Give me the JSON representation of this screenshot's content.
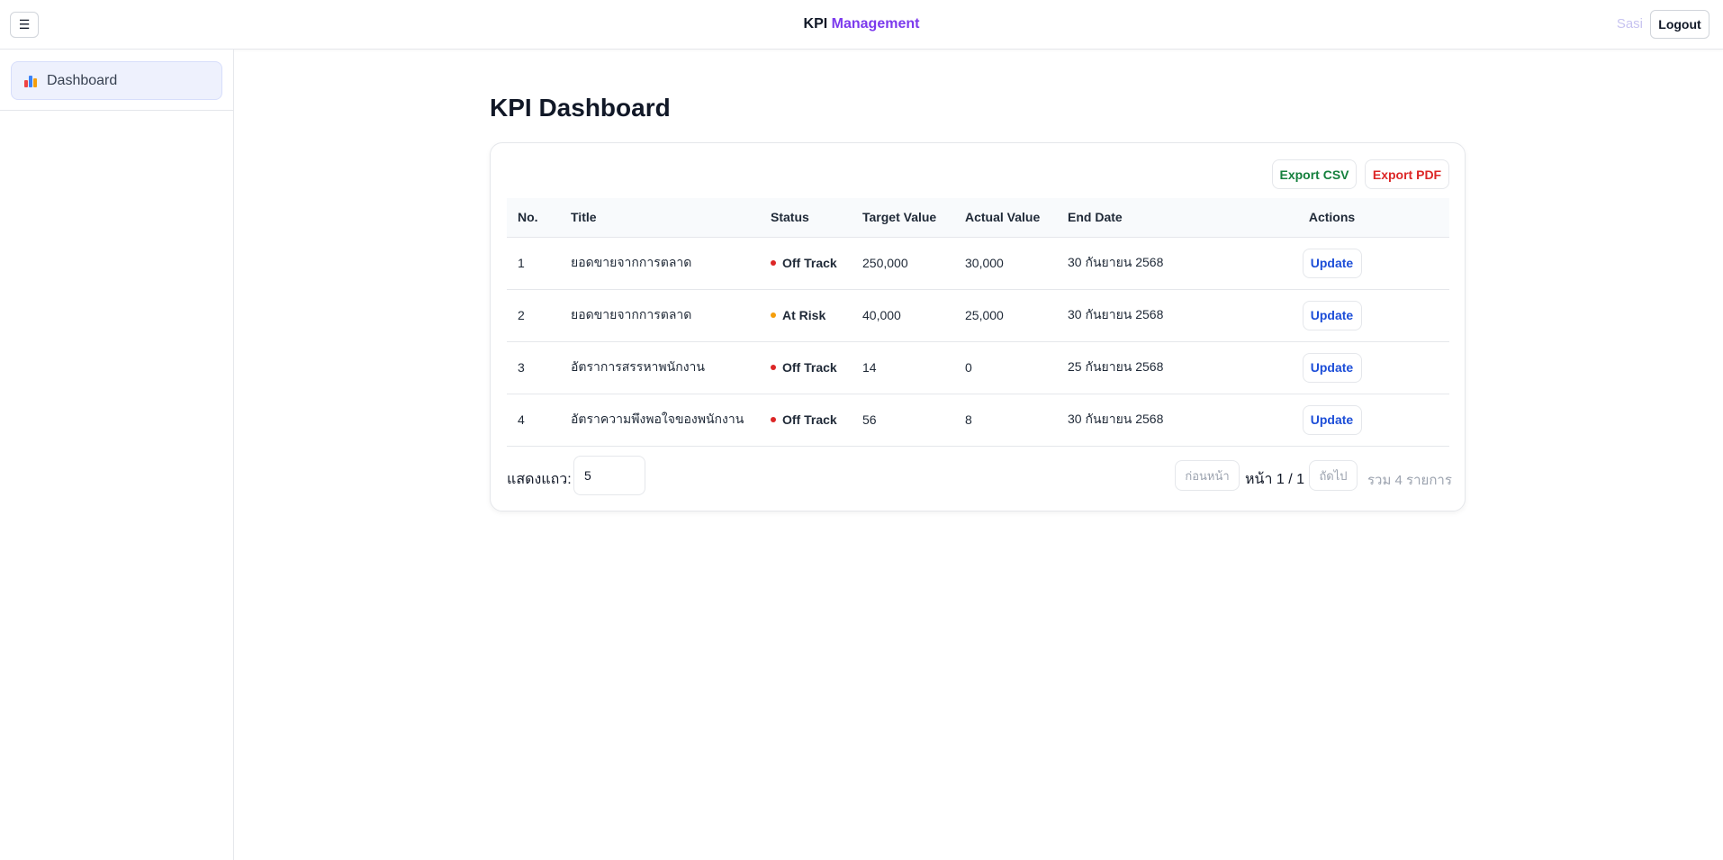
{
  "header": {
    "menu_icon": "☰",
    "brand_kpi": "KPI",
    "brand_management": "Management",
    "user_name": "Sasi",
    "logout_label": "Logout"
  },
  "sidebar": {
    "items": [
      {
        "label": "Dashboard",
        "icon": "bar-chart-icon",
        "active": true
      }
    ]
  },
  "main": {
    "title": "KPI Dashboard",
    "export_csv_label": "Export CSV",
    "export_pdf_label": "Export PDF",
    "columns": [
      "No.",
      "Title",
      "Status",
      "Target Value",
      "Actual Value",
      "End Date",
      "Actions"
    ],
    "rows": [
      {
        "no": "1",
        "title": "ยอดขายจากการตลาด",
        "status": "Off Track",
        "status_color": "#dc2626",
        "target": "250,000",
        "actual": "30,000",
        "end_date": "30 กันยายน 2568",
        "action": "Update"
      },
      {
        "no": "2",
        "title": "ยอดขายจากการตลาด",
        "status": "At Risk",
        "status_color": "#f59e0b",
        "target": "40,000",
        "actual": "25,000",
        "end_date": "30 กันยายน 2568",
        "action": "Update"
      },
      {
        "no": "3",
        "title": "อัตราการสรรหาพนักงาน",
        "status": "Off Track",
        "status_color": "#dc2626",
        "target": "14",
        "actual": "0",
        "end_date": "25 กันยายน 2568",
        "action": "Update"
      },
      {
        "no": "4",
        "title": "อัตราความพึงพอใจของพนักงาน",
        "status": "Off Track",
        "status_color": "#dc2626",
        "target": "56",
        "actual": "8",
        "end_date": "30 กันยายน 2568",
        "action": "Update"
      }
    ],
    "pagination": {
      "rows_label": "แสดงแถว:",
      "rows_value": "5",
      "prev_label": "ก่อนหน้า",
      "page_info": "หน้า 1 / 1",
      "next_label": "ถัดไป",
      "total_label": "รวม 4 รายการ"
    }
  }
}
